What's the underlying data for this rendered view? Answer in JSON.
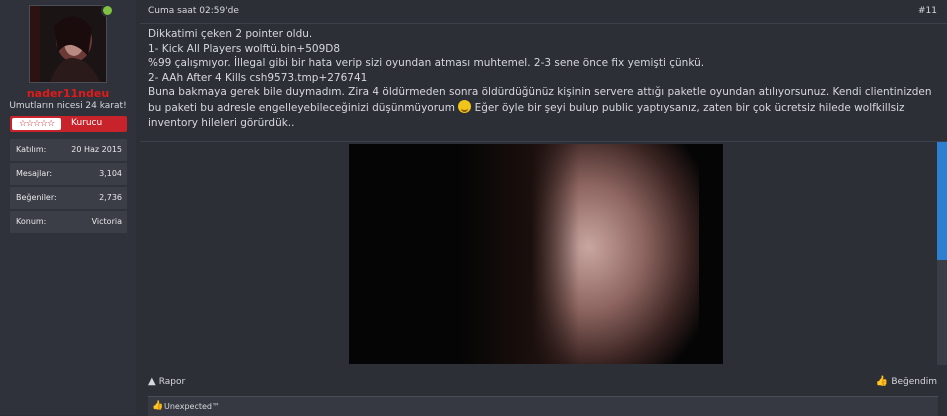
{
  "user": {
    "name": "nader11ndeu",
    "title": "Umutların nicesi 24 karat!",
    "rank_stars": "☆☆☆☆☆",
    "rank_label": "Kurucu",
    "online_color": "#7fc241",
    "stats": [
      {
        "k": "Katılım:",
        "v": "20 Haz 2015"
      },
      {
        "k": "Mesajlar:",
        "v": "3,104"
      },
      {
        "k": "Beğeniler:",
        "v": "2,736"
      },
      {
        "k": "Konum:",
        "v": "Victoria"
      }
    ]
  },
  "post": {
    "date": "Cuma saat 02:59'de",
    "number": "#11",
    "lines": [
      "Dikkatimi çeken 2 pointer oldu.",
      "1- Kick All Players wolftü.bin+509D8",
      "%99 çalışmıyor. İllegal gibi bir hata verip sizi oyundan atması muhtemel. 2-3 sene önce fix yemişti çünkü.",
      "2- AAh After 4 Kills csh9573.tmp+276741"
    ],
    "para_a": "Buna bakmaya gerek bile duymadım. Zira 4 öldürmeden sonra öldürdüğünüz kişinin servere attığı paketle oyundan atılıyorsunuz. Kendi clientinizden bu paketi bu adresle engelleyebileceğinizi düşünmüyorum",
    "para_b": " Eğer öyle bir şeyi bulup public yaptıysanız, zaten bir çok ücretsiz hilede wolfkillsiz inventory hileleri görürdük..",
    "emoji": "grinning-smiley-icon"
  },
  "actions": {
    "report_icon": "warning-icon",
    "report_label": "Rapor",
    "like_icon": "thumbs-up-icon",
    "like_label": "Beğendim"
  },
  "likes": {
    "icon": "thumbs-up-icon",
    "text": "Unexpected™"
  },
  "colors": {
    "username": "#e01a1a",
    "rank_bg": "#c8222a",
    "scroll_thumb": "#2f7fd0"
  }
}
